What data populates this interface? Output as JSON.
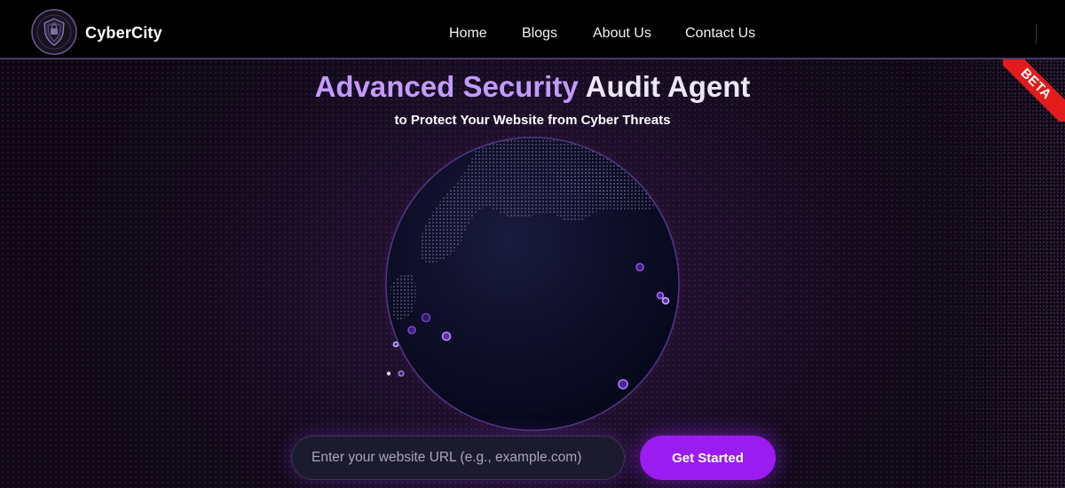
{
  "header": {
    "brand": "CyberCity",
    "logo_icon": "shield-emblem-icon",
    "nav": {
      "home": "Home",
      "blogs": "Blogs",
      "about": "About Us",
      "contact": "Contact Us"
    }
  },
  "hero": {
    "title_accent": "Advanced Security",
    "title_main": "Audit Agent",
    "subtitle": "to Protect Your Website from Cyber Threats",
    "badge": "BETA"
  },
  "form": {
    "url_placeholder": "Enter your website URL (e.g., example.com)",
    "submit_label": "Get Started"
  },
  "colors": {
    "accent": "#9a1cf0",
    "title_accent": "#c39aff",
    "badge": "#e21c1c",
    "background": "#0f0814"
  }
}
